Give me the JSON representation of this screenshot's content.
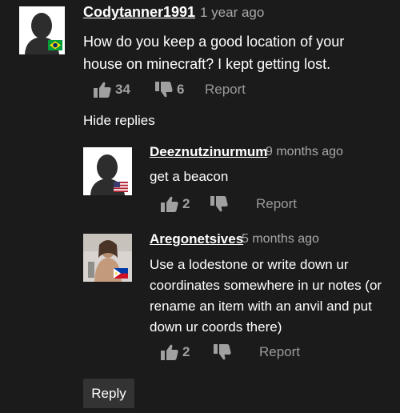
{
  "comments": [
    {
      "username": "Codytanner1991",
      "time": "1 year ago",
      "text_lines": [
        "How do you keep a good location of your",
        "house on minecraft? I kept getting lost."
      ],
      "likes": "34",
      "dislikes": "6",
      "report": "Report",
      "flag": "brazil-flag-icon"
    }
  ],
  "hide_replies": "Hide replies",
  "replies": [
    {
      "username": "Deeznutzinurmum",
      "time": "9 months ago",
      "text_lines": [
        "get a beacon"
      ],
      "likes": "2",
      "dislikes": "",
      "report": "Report",
      "flag": "usa-flag-icon"
    },
    {
      "username": "Aregonetsives",
      "time": "5 months ago",
      "text_lines": [
        "Use a lodestone or write down ur",
        "coordinates somewhere in ur notes (or",
        "rename an item with an anvil and put",
        "down ur coords there)"
      ],
      "likes": "2",
      "dislikes": "",
      "report": "Report",
      "flag": "philippines-flag-icon"
    }
  ],
  "reply_button": "Reply",
  "colors": {
    "background": "#1b1b1b",
    "username": "#ffffff",
    "timestamp": "#a8a8a8",
    "action": "#a0a0a0",
    "reply_button_bg": "#333333"
  }
}
